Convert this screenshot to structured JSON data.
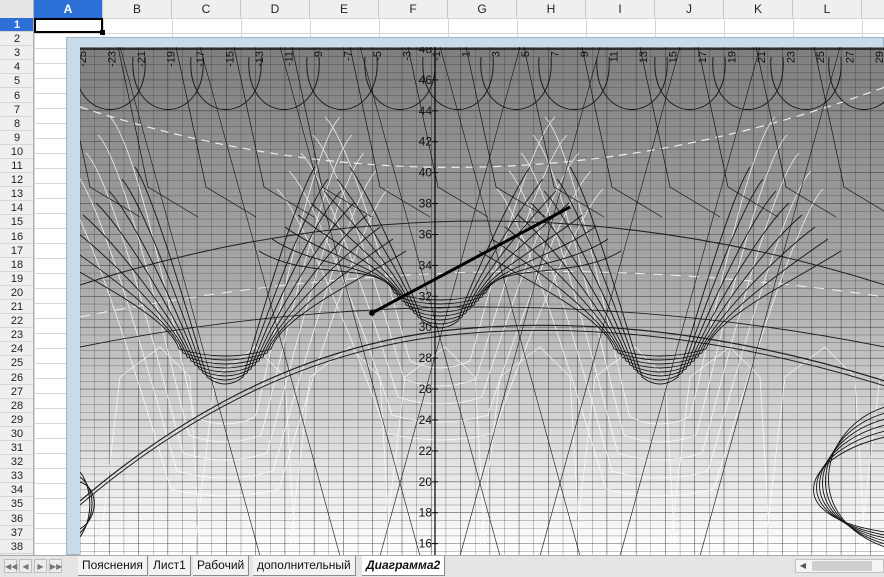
{
  "sheet": {
    "columns": [
      "A",
      "B",
      "C",
      "D",
      "E",
      "F",
      "G",
      "H",
      "I",
      "J",
      "K",
      "L"
    ],
    "selected_column": "A",
    "rows": [
      "1",
      "2",
      "3",
      "4",
      "5",
      "6",
      "7",
      "8",
      "9",
      "10",
      "11",
      "12",
      "13",
      "14",
      "15",
      "16",
      "17",
      "18",
      "19",
      "20",
      "21",
      "22",
      "23",
      "24",
      "25",
      "26",
      "27",
      "28",
      "29",
      "30",
      "31",
      "32",
      "33",
      "34",
      "35",
      "36",
      "37",
      "38"
    ],
    "selected_row": "1"
  },
  "chart": {
    "y_labels": [
      "48",
      "46",
      "44",
      "42",
      "40",
      "38",
      "36",
      "34",
      "32",
      "30",
      "28",
      "26",
      "24",
      "22",
      "20",
      "18",
      "16"
    ],
    "x_labels_top": [
      "-25",
      "-23",
      "-21",
      "-19",
      "-17",
      "-15",
      "-13",
      "-11",
      "-9",
      "-7",
      "-5",
      "-3",
      "-1",
      "1",
      "3",
      "5",
      "7",
      "9",
      "11",
      "13",
      "15",
      "17",
      "19",
      "21",
      "23",
      "25",
      "27",
      "29"
    ]
  },
  "tabs": {
    "items": [
      "Пояснения",
      "Лист1",
      "Рабочий",
      "дополнительный",
      "Диаграмма2"
    ],
    "active": "Диаграмма2"
  }
}
